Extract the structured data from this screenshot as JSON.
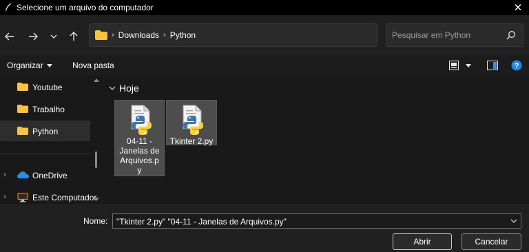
{
  "window": {
    "title": "Selecione um arquivo do computador"
  },
  "address": {
    "crumbs": [
      "Downloads",
      "Python"
    ]
  },
  "search": {
    "placeholder": "Pesquisar em Python"
  },
  "commands": {
    "organize": "Organizar",
    "new_folder": "Nova pasta"
  },
  "sidebar": {
    "items": [
      {
        "label": "Youtube",
        "icon": "folder-icon"
      },
      {
        "label": "Trabalho",
        "icon": "folder-icon"
      },
      {
        "label": "Python",
        "icon": "folder-icon",
        "active": true
      },
      {
        "label": "OneDrive",
        "icon": "cloud-icon"
      },
      {
        "label": "Este Computador",
        "icon": "computer-icon"
      }
    ]
  },
  "content": {
    "group": "Hoje",
    "files": [
      {
        "name": "04-11 - Janelas de Arquivos.py",
        "lines": [
          "04-11 -",
          "Janelas de",
          "Arquivos.p",
          "y"
        ],
        "selected": true
      },
      {
        "name": "Tkinter 2.py",
        "lines": [
          "Tkinter 2.py"
        ],
        "selected": true
      }
    ]
  },
  "footer": {
    "name_label": "Nome:",
    "name_value": "\"Tkinter 2.py\" \"04-11 - Janelas de Arquivos.py\"",
    "open_label": "Abrir",
    "cancel_label": "Cancelar"
  },
  "colors": {
    "folder": "#f5c242",
    "python_blue": "#3b77a8",
    "python_yellow": "#f7d53a",
    "help": "#1e88e5",
    "onedrive": "#2b8ce8"
  }
}
